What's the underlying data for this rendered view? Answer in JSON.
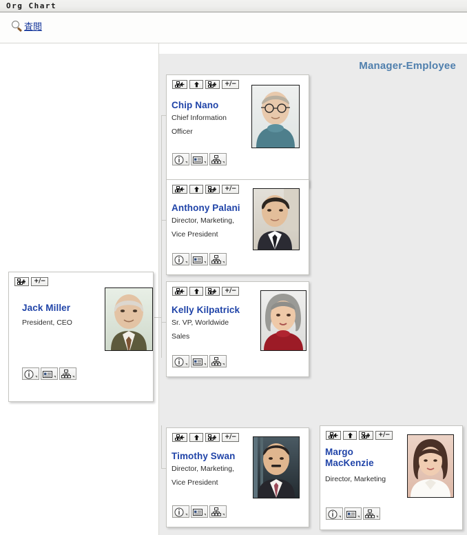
{
  "window": {
    "title": "Org Chart"
  },
  "toolbar": {
    "search_label": "査閲",
    "search_icon": "magnifier-icon"
  },
  "panel": {
    "heading": "Manager-Employee"
  },
  "colors": {
    "name_blue": "#2044a8",
    "heading_blue": "#4f7fad",
    "link_blue": "#17389c",
    "panel_bg": "#ebebeb",
    "card_bg": "#ffffff",
    "card_border": "#c4c4c0"
  },
  "card_buttons": {
    "top": [
      {
        "name": "go-to-manager-button",
        "icon": "org-left-arrow-icon",
        "label": ""
      },
      {
        "name": "move-up-button",
        "icon": "up-arrow-icon",
        "label": ""
      },
      {
        "name": "expand-subtree-button",
        "icon": "org-plus-icon",
        "label": ""
      },
      {
        "name": "toggle-expand-button",
        "icon": "plus-minus-icon",
        "label": "+/−"
      }
    ],
    "bottom": [
      {
        "name": "info-button",
        "icon": "info-circle-icon"
      },
      {
        "name": "contact-card-button",
        "icon": "business-card-icon"
      },
      {
        "name": "org-hierarchy-button",
        "icon": "hierarchy-icon"
      }
    ]
  },
  "root_card": {
    "name": "Jack Miller",
    "title_lines": [
      "President, CEO"
    ],
    "photo": "portrait-jack-miller",
    "top_buttons": [
      {
        "name": "expand-subtree-button",
        "icon": "org-plus-icon"
      },
      {
        "name": "toggle-expand-button",
        "icon": "plus-minus-icon",
        "label": "+/−"
      }
    ]
  },
  "employee_cards": [
    {
      "name": "Chip Nano",
      "title_lines": [
        "Chief Information",
        "Officer"
      ],
      "photo": "portrait-chip-nano"
    },
    {
      "name": "Anthony Palani",
      "title_lines": [
        "Director, Marketing,",
        "Vice President"
      ],
      "photo": "portrait-anthony-palani"
    },
    {
      "name": "Kelly Kilpatrick",
      "title_lines": [
        "Sr. VP, Worldwide",
        "Sales"
      ],
      "photo": "portrait-kelly-kilpatrick"
    },
    {
      "name": "Timothy Swan",
      "title_lines": [
        "Director, Marketing,",
        "Vice President"
      ],
      "photo": "portrait-timothy-swan"
    },
    {
      "name": "Margo MacKenzie",
      "name_lines": [
        "Margo",
        "MacKenzie"
      ],
      "title_lines": [
        "Director, Marketing"
      ],
      "photo": "portrait-margo-mackenzie"
    }
  ]
}
